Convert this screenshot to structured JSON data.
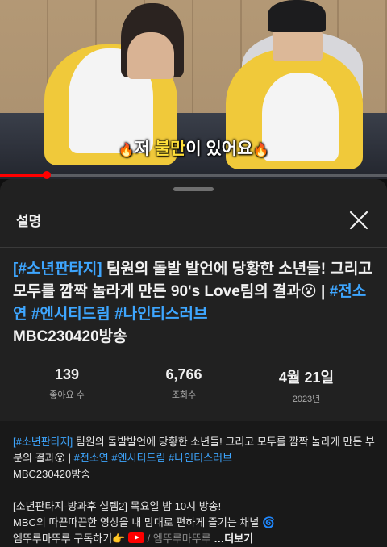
{
  "video": {
    "caption_pre": "저 ",
    "caption_hl": "불만",
    "caption_post": "이 있어요",
    "progress": 0.12
  },
  "sheet": {
    "title": "설명",
    "close_icon": "close-icon"
  },
  "title": {
    "tag1": "[#소년판타지]",
    "text1": " 팀원의 돌발 발언에 당황한 소년들! 그리고 모두를 깜짝 놀라게 만든 90's Love팀의 결과",
    "emoji": "😮",
    "sep": " | ",
    "tag2": "#전소연",
    "tag3": "#엔시티드림",
    "tag4": "#나인티스러브",
    "text2": "MBC230420방송"
  },
  "stats": {
    "likes_value": "139",
    "likes_label": "좋아요 수",
    "views_value": "6,766",
    "views_label": "조회수",
    "date_value": "4월 21일",
    "date_label": "2023년"
  },
  "description": {
    "tag1": "[#소년판타지]",
    "text1": " 팀원의 돌발발언에 당황한 소년들! 그리고 모두를 깜짝 놀라게 만든 부분의 결과",
    "emoji": "😮",
    "sep": " | ",
    "tag2": "#전소연",
    "tag3": "#엔시티드림",
    "tag4": "#나인티스러브",
    "line2": "MBC230420방송",
    "line3": "[소년판타지-방과후 설렘2] 목요일 밤 10시 방송!",
    "line4": "MBC의 따끈따끈한 영상을 내 맘대로 편하게 즐기는 채널",
    "line4_emoji": "🌀",
    "line5_a": "엠뚜루마뚜루 구독하기",
    "line5_emoji": "👉",
    "line5_b": " / 엠뚜루마뚜루",
    "more": " …더보기"
  }
}
